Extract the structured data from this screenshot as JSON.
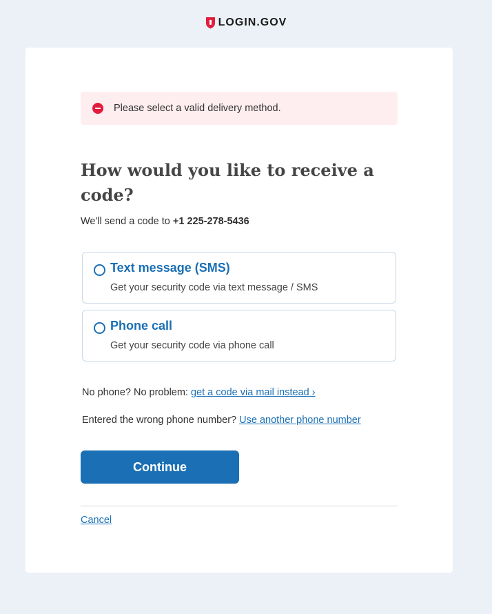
{
  "brand": {
    "text": "LOGIN.GOV",
    "icon": "shield-icon",
    "color": "#e21c3d"
  },
  "alert": {
    "icon": "error-minus-circle-icon",
    "message": "Please select a valid delivery method."
  },
  "heading": "How would you like to receive a code?",
  "sent": {
    "prefix": "We'll send a code to",
    "phone": "+1 225-278-5436"
  },
  "options": [
    {
      "title": "Text message (SMS)",
      "description": "Get your security code via text message / SMS",
      "selected": false
    },
    {
      "title": "Phone call",
      "description": "Get your security code via phone call",
      "selected": false
    }
  ],
  "help": {
    "mail_prefix": "No phone? No problem:",
    "mail_link": "get a code via mail instead ›",
    "wrong_prefix": "Entered the wrong phone number?",
    "wrong_link": "Use another phone number"
  },
  "actions": {
    "continue_label": "Continue",
    "cancel_label": "Cancel"
  },
  "colors": {
    "accent": "#1a6fb5",
    "alert_bg": "#ffeef0",
    "page_bg": "#ecf1f7"
  }
}
